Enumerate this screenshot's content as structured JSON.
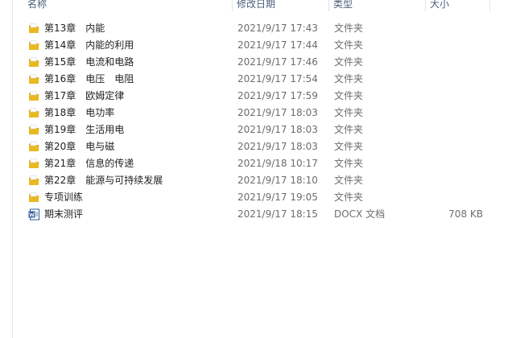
{
  "columns": {
    "name": "名称",
    "date": "修改日期",
    "type": "类型",
    "size": "大小"
  },
  "files": [
    {
      "name": "第13章　内能",
      "date": "2021/9/17 17:43",
      "type": "文件夹",
      "size": "",
      "icon": "folder-icon"
    },
    {
      "name": "第14章　内能的利用",
      "date": "2021/9/17 17:44",
      "type": "文件夹",
      "size": "",
      "icon": "folder-icon"
    },
    {
      "name": "第15章　电流和电路",
      "date": "2021/9/17 17:46",
      "type": "文件夹",
      "size": "",
      "icon": "folder-icon"
    },
    {
      "name": "第16章　电压　电阻",
      "date": "2021/9/17 17:54",
      "type": "文件夹",
      "size": "",
      "icon": "folder-icon"
    },
    {
      "name": "第17章　欧姆定律",
      "date": "2021/9/17 17:59",
      "type": "文件夹",
      "size": "",
      "icon": "folder-icon"
    },
    {
      "name": "第18章　电功率",
      "date": "2021/9/17 18:03",
      "type": "文件夹",
      "size": "",
      "icon": "folder-icon"
    },
    {
      "name": "第19章　生活用电",
      "date": "2021/9/17 18:03",
      "type": "文件夹",
      "size": "",
      "icon": "folder-icon"
    },
    {
      "name": "第20章　电与磁",
      "date": "2021/9/17 18:03",
      "type": "文件夹",
      "size": "",
      "icon": "folder-icon"
    },
    {
      "name": "第21章　信息的传递",
      "date": "2021/9/18 10:17",
      "type": "文件夹",
      "size": "",
      "icon": "folder-icon"
    },
    {
      "name": "第22章　能源与可持续发展",
      "date": "2021/9/17 18:10",
      "type": "文件夹",
      "size": "",
      "icon": "folder-icon"
    },
    {
      "name": "专项训练",
      "date": "2021/9/17 19:05",
      "type": "文件夹",
      "size": "",
      "icon": "folder-icon"
    },
    {
      "name": "期末测评",
      "date": "2021/9/17 18:15",
      "type": "DOCX 文档",
      "size": "708 KB",
      "icon": "word-document-icon"
    }
  ],
  "colors": {
    "folder": "#e8b923",
    "folder_dark": "#d9a514",
    "word_blue": "#2b5797"
  }
}
